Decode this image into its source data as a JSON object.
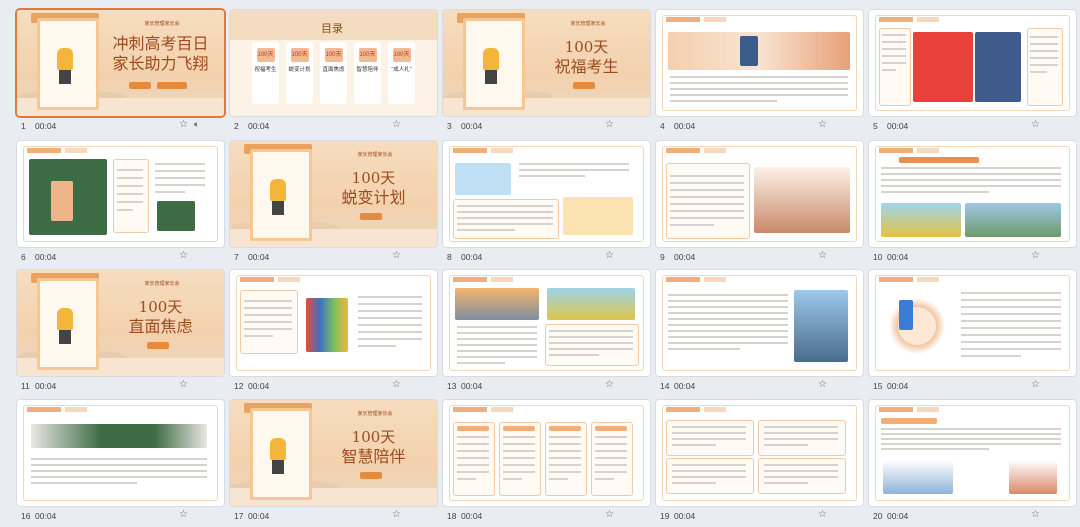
{
  "slides": [
    {
      "number": "1",
      "duration": "00:04",
      "type": "cover",
      "title_l1": "冲刺高考百日",
      "title_l2": "家长助力飞翔",
      "tag": "家长管理家长会",
      "selected": true,
      "sound": true
    },
    {
      "number": "2",
      "duration": "00:04",
      "type": "toc",
      "title": "目录",
      "cards": [
        {
          "n": "100天",
          "t": "祝福考生"
        },
        {
          "n": "100天",
          "t": "蜕变计划"
        },
        {
          "n": "100天",
          "t": "直面焦虑"
        },
        {
          "n": "100天",
          "t": "智慧陪伴"
        },
        {
          "n": "100天",
          "t": "“成人礼”"
        }
      ]
    },
    {
      "number": "3",
      "duration": "00:04",
      "type": "section",
      "title_l1": "100天",
      "title_l2": "祝福考生",
      "tag": "家长管理家长会"
    },
    {
      "number": "4",
      "duration": "00:04",
      "type": "content",
      "variant": "a"
    },
    {
      "number": "5",
      "duration": "00:04",
      "type": "content",
      "variant": "b"
    },
    {
      "number": "6",
      "duration": "00:04",
      "type": "content",
      "variant": "c"
    },
    {
      "number": "7",
      "duration": "00:04",
      "type": "section",
      "title_l1": "100天",
      "title_l2": "蜕变计划",
      "tag": "家长管理家长会"
    },
    {
      "number": "8",
      "duration": "00:04",
      "type": "content",
      "variant": "d"
    },
    {
      "number": "9",
      "duration": "00:04",
      "type": "content",
      "variant": "e"
    },
    {
      "number": "10",
      "duration": "00:04",
      "type": "content",
      "variant": "f"
    },
    {
      "number": "11",
      "duration": "00:04",
      "type": "section",
      "title_l1": "100天",
      "title_l2": "直面焦虑",
      "tag": "家长管理家长会"
    },
    {
      "number": "12",
      "duration": "00:04",
      "type": "content",
      "variant": "g"
    },
    {
      "number": "13",
      "duration": "00:04",
      "type": "content",
      "variant": "h"
    },
    {
      "number": "14",
      "duration": "00:04",
      "type": "content",
      "variant": "i"
    },
    {
      "number": "15",
      "duration": "00:04",
      "type": "content",
      "variant": "j"
    },
    {
      "number": "16",
      "duration": "00:04",
      "type": "content",
      "variant": "k"
    },
    {
      "number": "17",
      "duration": "00:04",
      "type": "section",
      "title_l1": "100天",
      "title_l2": "智慧陪伴",
      "tag": "家长管理家长会"
    },
    {
      "number": "18",
      "duration": "00:04",
      "type": "content",
      "variant": "l"
    },
    {
      "number": "19",
      "duration": "00:04",
      "type": "content",
      "variant": "m"
    },
    {
      "number": "20",
      "duration": "00:04",
      "type": "content",
      "variant": "n"
    }
  ],
  "icons": {
    "star": "star-icon",
    "sound": "speaker-icon"
  },
  "colors": {
    "accent": "#e0793a",
    "background": "#e9ecf1",
    "title": "#9b4c1e"
  }
}
